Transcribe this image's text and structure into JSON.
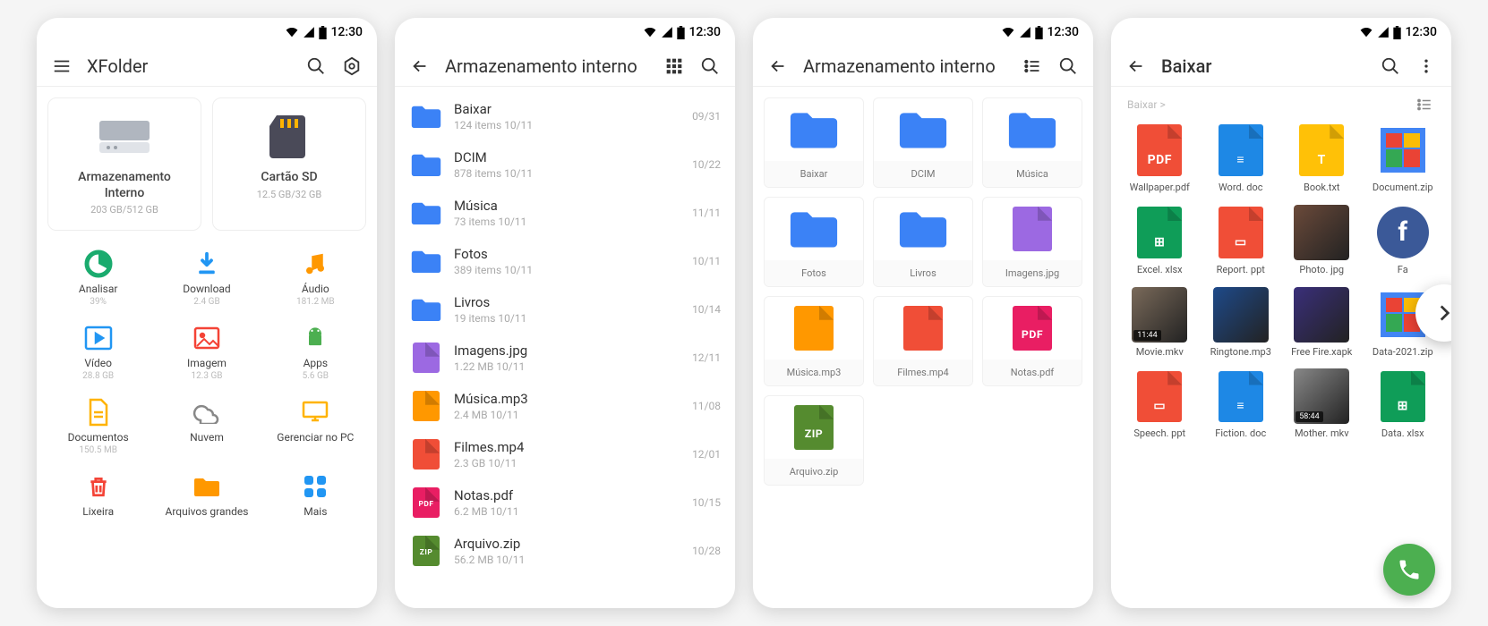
{
  "status_time": "12:30",
  "screen1": {
    "title": "XFolder",
    "storage": [
      {
        "name": "Armazenamento Interno",
        "sub": "203 GB/512 GB"
      },
      {
        "name": "Cartão SD",
        "sub": "12.5 GB/32 GB"
      }
    ],
    "categories": [
      {
        "label": "Analisar",
        "sub": "39%",
        "color": "#1aab6e",
        "icon": "pie"
      },
      {
        "label": "Download",
        "sub": "2.4 GB",
        "color": "#2196f3",
        "icon": "download"
      },
      {
        "label": "Áudio",
        "sub": "181.2 MB",
        "color": "#ff9800",
        "icon": "music"
      },
      {
        "label": "Vídeo",
        "sub": "28.8 GB",
        "color": "#2196f3",
        "icon": "video"
      },
      {
        "label": "Imagem",
        "sub": "12.3 GB",
        "color": "#f44336",
        "icon": "image"
      },
      {
        "label": "Apps",
        "sub": "5.6 GB",
        "color": "#4caf50",
        "icon": "android"
      },
      {
        "label": "Documentos",
        "sub": "150.5 MB",
        "color": "#ffb300",
        "icon": "doc"
      },
      {
        "label": "Nuvem",
        "sub": "",
        "color": "#888",
        "icon": "cloud"
      },
      {
        "label": "Gerenciar no PC",
        "sub": "",
        "color": "#ffb300",
        "icon": "pc"
      },
      {
        "label": "Lixeira",
        "sub": "",
        "color": "#f44336",
        "icon": "trash"
      },
      {
        "label": "Arquivos grandes",
        "sub": "",
        "color": "#ff9800",
        "icon": "bigfolder"
      },
      {
        "label": "Mais",
        "sub": "",
        "color": "#2196f3",
        "icon": "more"
      }
    ]
  },
  "screen2": {
    "title": "Armazenamento interno",
    "items": [
      {
        "name": "Baixar",
        "sub": "124 items 10/11",
        "date": "09/31",
        "type": "folder",
        "color": "#3b82f6",
        "badge": "download"
      },
      {
        "name": "DCIM",
        "sub": "878 items 10/11",
        "date": "10/22",
        "type": "folder",
        "color": "#3b82f6",
        "badge": "camera"
      },
      {
        "name": "Música",
        "sub": "73 items   10/11",
        "date": "11/11",
        "type": "folder",
        "color": "#3b82f6",
        "badge": "music"
      },
      {
        "name": "Fotos",
        "sub": "389 items 10/11",
        "date": "10/11",
        "type": "folder",
        "color": "#3b82f6",
        "badge": "image"
      },
      {
        "name": "Livros",
        "sub": "19 items   10/11",
        "date": "10/14",
        "type": "folder",
        "color": "#3b82f6",
        "badge": ""
      },
      {
        "name": "Imagens.jpg",
        "sub": "1.22 MB   10/11",
        "date": "12/11",
        "type": "file",
        "color": "#9c69e2",
        "ext": ""
      },
      {
        "name": "Música.mp3",
        "sub": "2.4 MB    10/11",
        "date": "11/08",
        "type": "file",
        "color": "#ff9800",
        "ext": ""
      },
      {
        "name": "Filmes.mp4",
        "sub": "2.3 GB    10/11",
        "date": "12/01",
        "type": "file",
        "color": "#f04e37",
        "ext": ""
      },
      {
        "name": "Notas.pdf",
        "sub": "6.2 MB    10/11",
        "date": "10/15",
        "type": "file",
        "color": "#e91e63",
        "ext": "PDF"
      },
      {
        "name": "Arquivo.zip",
        "sub": "56.2 MB   10/11",
        "date": "10/28",
        "type": "file",
        "color": "#558b2f",
        "ext": "ZIP"
      }
    ]
  },
  "screen3": {
    "title": "Armazenamento interno",
    "items": [
      {
        "label": "Baixar",
        "type": "folder",
        "color": "#3b82f6",
        "ext": ""
      },
      {
        "label": "DCIM",
        "type": "folder",
        "color": "#3b82f6",
        "ext": ""
      },
      {
        "label": "Música",
        "type": "folder",
        "color": "#3b82f6",
        "ext": ""
      },
      {
        "label": "Fotos",
        "type": "folder",
        "color": "#3b82f6",
        "ext": ""
      },
      {
        "label": "Livros",
        "type": "folder",
        "color": "#3b82f6",
        "ext": ""
      },
      {
        "label": "Imagens.jpg",
        "type": "file",
        "color": "#9c69e2",
        "ext": ""
      },
      {
        "label": "Música.mp3",
        "type": "file",
        "color": "#ff9800",
        "ext": ""
      },
      {
        "label": "Filmes.mp4",
        "type": "file",
        "color": "#f04e37",
        "ext": ""
      },
      {
        "label": "Notas.pdf",
        "type": "file",
        "color": "#e91e63",
        "ext": "PDF"
      },
      {
        "label": "Arquivo.zip",
        "type": "file",
        "color": "#558b2f",
        "ext": "ZIP"
      }
    ]
  },
  "screen4": {
    "title": "Baixar",
    "breadcrumb": "Baixar >",
    "items": [
      {
        "label": "Wallpaper.pdf",
        "color": "#f04e37",
        "ext": "PDF",
        "type": "doc"
      },
      {
        "label": "Word. doc",
        "color": "#1e88e5",
        "ext": "≡",
        "type": "doc"
      },
      {
        "label": "Book.txt",
        "color": "#ffc107",
        "ext": "T",
        "type": "doc"
      },
      {
        "label": "Document.zip",
        "color": "#4285f4",
        "ext": "",
        "type": "zip-multi"
      },
      {
        "label": "Excel. xlsx",
        "color": "#0f9d58",
        "ext": "⊞",
        "type": "doc"
      },
      {
        "label": "Report. ppt",
        "color": "#f04e37",
        "ext": "▭",
        "type": "doc"
      },
      {
        "label": "Photo. jpg",
        "color": "#6b4a3a",
        "ext": "",
        "type": "photo"
      },
      {
        "label": "Fa",
        "color": "#3b5998",
        "ext": "f",
        "type": "circle"
      },
      {
        "label": "Movie.mkv",
        "color": "#7a6a5a",
        "ext": "",
        "type": "photo",
        "badge": "11:44"
      },
      {
        "label": "Ringtone.mp3",
        "color": "#1e4a8a",
        "ext": "",
        "type": "photo"
      },
      {
        "label": "Free Fire.xapk",
        "color": "#3a2f7a",
        "ext": "",
        "type": "photo"
      },
      {
        "label": "Data-2021.zip",
        "color": "#4285f4",
        "ext": "",
        "type": "zip-multi"
      },
      {
        "label": "Speech. ppt",
        "color": "#f04e37",
        "ext": "▭",
        "type": "doc"
      },
      {
        "label": "Fiction. doc",
        "color": "#1e88e5",
        "ext": "≡",
        "type": "doc"
      },
      {
        "label": "Mother. mkv",
        "color": "#888",
        "ext": "",
        "type": "photo",
        "badge": "58:44"
      },
      {
        "label": "Data. xlsx",
        "color": "#0f9d58",
        "ext": "⊞",
        "type": "doc"
      }
    ]
  }
}
